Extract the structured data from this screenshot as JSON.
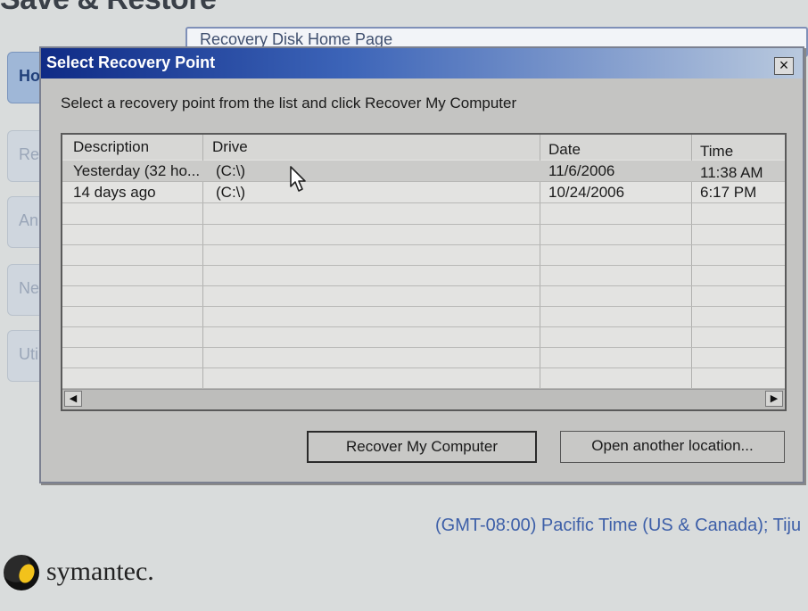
{
  "background": {
    "title": "Save & Restore",
    "address_text": "Recovery Disk Home Page",
    "nav_items": [
      "Ho",
      "Re",
      "An",
      "Ne",
      "Uti"
    ],
    "timezone": "(GMT-08:00) Pacific Time (US & Canada); Tiju",
    "logo_text": "symantec."
  },
  "dialog": {
    "title": "Select Recovery Point",
    "close_label": "×",
    "instruction": "Select a recovery point from the list and click Recover My Computer",
    "columns": [
      "Description",
      "Drive",
      "Date",
      "Time"
    ],
    "rows": [
      {
        "description": "Yesterday (32 ho...",
        "drive": "(C:\\)",
        "date": "11/6/2006",
        "time": "11:38 AM"
      },
      {
        "description": "14 days ago",
        "drive": "(C:\\)",
        "date": "10/24/2006",
        "time": "6:17 PM"
      }
    ],
    "scroll_left": "◀",
    "scroll_right": "▶",
    "buttons": {
      "recover": "Recover My Computer",
      "open_location": "Open another location..."
    }
  }
}
